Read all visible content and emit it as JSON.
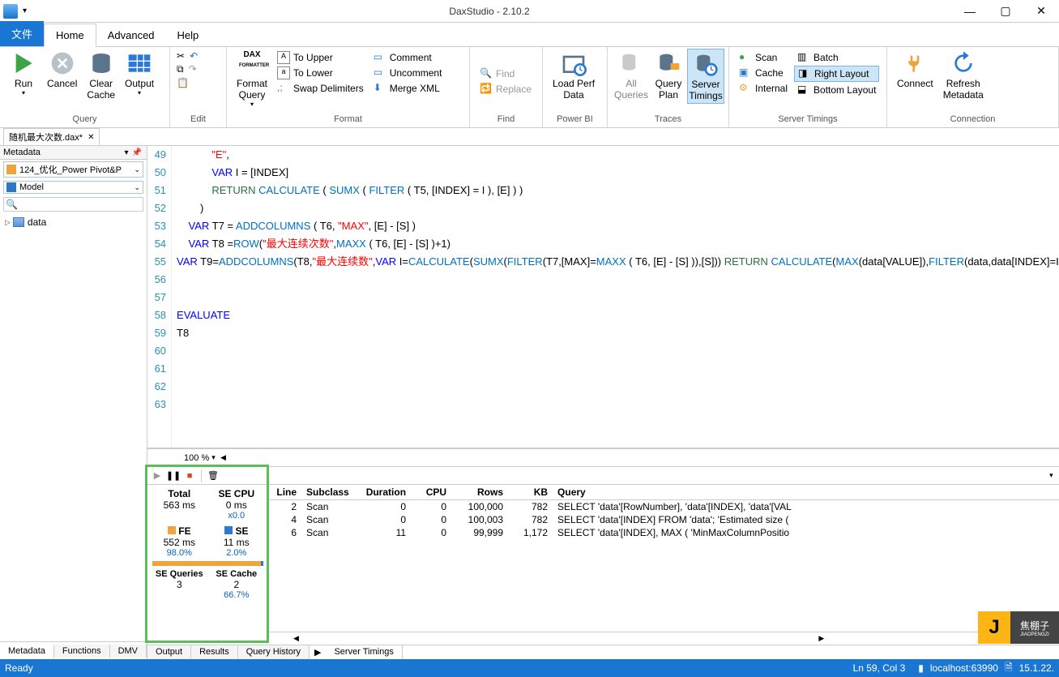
{
  "titlebar": {
    "title": "DaxStudio - 2.10.2"
  },
  "tabs": {
    "file": "文件",
    "home": "Home",
    "advanced": "Advanced",
    "help": "Help"
  },
  "ribbon": {
    "query": {
      "label": "Query",
      "run": "Run",
      "cancel": "Cancel",
      "clear_cache": "Clear\nCache",
      "output": "Output"
    },
    "edit": {
      "label": "Edit"
    },
    "format": {
      "label": "Format",
      "format_query": "Format\nQuery",
      "to_upper": "To Upper",
      "to_lower": "To Lower",
      "swap": "Swap Delimiters",
      "comment": "Comment",
      "uncomment": "Uncomment",
      "merge_xml": "Merge XML"
    },
    "find": {
      "label": "Find",
      "find": "Find",
      "replace": "Replace"
    },
    "powerbi": {
      "label": "Power BI",
      "load_perf": "Load Perf\nData"
    },
    "traces": {
      "label": "Traces",
      "all_queries": "All\nQueries",
      "query_plan": "Query\nPlan",
      "server_timings": "Server\nTimings"
    },
    "server_timings": {
      "label": "Server Timings",
      "scan": "Scan",
      "cache": "Cache",
      "internal": "Internal",
      "batch": "Batch",
      "right_layout": "Right Layout",
      "bottom_layout": "Bottom Layout"
    },
    "connection": {
      "label": "Connection",
      "connect": "Connect",
      "refresh": "Refresh\nMetadata"
    }
  },
  "doctab": {
    "name": "随机最大次数.dax*"
  },
  "metadata": {
    "title": "Metadata",
    "db": "124_优化_Power Pivot&P",
    "model": "Model",
    "table": "data"
  },
  "editor": {
    "zoom": "100 %",
    "lines": [
      {
        "n": 49,
        "ind": 3,
        "seg": [
          {
            "t": "\"E\"",
            "c": "strcn"
          },
          {
            "t": ",",
            "c": ""
          }
        ]
      },
      {
        "n": 50,
        "ind": 3,
        "seg": [
          {
            "t": "VAR",
            "c": "kw"
          },
          {
            "t": " I = [INDEX]",
            "c": ""
          }
        ]
      },
      {
        "n": 51,
        "ind": 3,
        "seg": [
          {
            "t": "RETURN",
            "c": "rtn"
          },
          {
            "t": " ",
            "c": ""
          },
          {
            "t": "CALCULATE",
            "c": "fn"
          },
          {
            "t": " ( ",
            "c": ""
          },
          {
            "t": "SUMX",
            "c": "fn"
          },
          {
            "t": " ( ",
            "c": ""
          },
          {
            "t": "FILTER",
            "c": "fn"
          },
          {
            "t": " ( T5, [INDEX] = I ), [E] ) )",
            "c": ""
          }
        ]
      },
      {
        "n": 52,
        "ind": 2,
        "seg": [
          {
            "t": ")",
            "c": ""
          }
        ]
      },
      {
        "n": 53,
        "ind": 1,
        "seg": [
          {
            "t": "VAR",
            "c": "kw"
          },
          {
            "t": " T7 = ",
            "c": ""
          },
          {
            "t": "ADDCOLUMNS",
            "c": "fn"
          },
          {
            "t": " ( T6, ",
            "c": ""
          },
          {
            "t": "\"MAX\"",
            "c": "strcn"
          },
          {
            "t": ", [E] - [S] )",
            "c": ""
          }
        ]
      },
      {
        "n": 54,
        "ind": 1,
        "seg": [
          {
            "t": "VAR",
            "c": "kw"
          },
          {
            "t": " T8 =",
            "c": ""
          },
          {
            "t": "ROW",
            "c": "fn"
          },
          {
            "t": "(",
            "c": ""
          },
          {
            "t": "\"最大连续次数\"",
            "c": "strcn"
          },
          {
            "t": ",",
            "c": ""
          },
          {
            "t": "MAXX",
            "c": "fn"
          },
          {
            "t": " ( T6, [E] - [S] )+1)",
            "c": ""
          }
        ]
      },
      {
        "n": 55,
        "ind": 0,
        "seg": [
          {
            "t": "VAR",
            "c": "kw"
          },
          {
            "t": " T9=",
            "c": ""
          },
          {
            "t": "ADDCOLUMNS",
            "c": "fn"
          },
          {
            "t": "(T8,",
            "c": ""
          },
          {
            "t": "\"最大连续数\"",
            "c": "strcn"
          },
          {
            "t": ",",
            "c": ""
          },
          {
            "t": "VAR",
            "c": "kw"
          },
          {
            "t": " I=",
            "c": ""
          },
          {
            "t": "CALCULATE",
            "c": "fn"
          },
          {
            "t": "(",
            "c": ""
          },
          {
            "t": "SUMX",
            "c": "fn"
          },
          {
            "t": "(",
            "c": ""
          },
          {
            "t": "FILTER",
            "c": "fn"
          },
          {
            "t": "(T7,[MAX]=",
            "c": ""
          },
          {
            "t": "MAXX",
            "c": "fn"
          },
          {
            "t": " ( T6, [E] - [S] )),[S])) ",
            "c": ""
          },
          {
            "t": "RETURN",
            "c": "rtn"
          },
          {
            "t": " ",
            "c": ""
          },
          {
            "t": "CALCULATE",
            "c": "fn"
          },
          {
            "t": "(",
            "c": ""
          },
          {
            "t": "MAX",
            "c": "fn"
          },
          {
            "t": "(data[VALUE]),",
            "c": ""
          },
          {
            "t": "FILTER",
            "c": "fn"
          },
          {
            "t": "(data,data[INDEX]=I) ))",
            "c": ""
          }
        ]
      },
      {
        "n": 56,
        "ind": 0,
        "seg": []
      },
      {
        "n": 57,
        "ind": 0,
        "seg": []
      },
      {
        "n": 58,
        "ind": 0,
        "seg": [
          {
            "t": "EVALUATE",
            "c": "kw"
          }
        ]
      },
      {
        "n": 59,
        "ind": 0,
        "seg": [
          {
            "t": "T8",
            "c": ""
          }
        ]
      },
      {
        "n": 60,
        "ind": 0,
        "seg": []
      },
      {
        "n": 61,
        "ind": 0,
        "seg": []
      },
      {
        "n": 62,
        "ind": 0,
        "seg": []
      },
      {
        "n": 63,
        "ind": 0,
        "seg": []
      }
    ]
  },
  "timings": {
    "stats": {
      "total_h": "Total",
      "total": "563 ms",
      "secpu_h": "SE CPU",
      "secpu": "0 ms",
      "secpu_x": "x0.0",
      "fe_h": "FE",
      "fe": "552 ms",
      "fe_pct": "98.0%",
      "se_h": "SE",
      "se": "11 ms",
      "se_pct": "2.0%",
      "seq_h": "SE Queries",
      "seq": "3",
      "sec_h": "SE Cache",
      "sec": "2",
      "sec_pct": "66.7%"
    },
    "cols": {
      "line": "Line",
      "subclass": "Subclass",
      "duration": "Duration",
      "cpu": "CPU",
      "rows": "Rows",
      "kb": "KB",
      "query": "Query"
    },
    "rows": [
      {
        "line": "2",
        "subclass": "Scan",
        "duration": "0",
        "cpu": "0",
        "rows": "100,000",
        "kb": "782",
        "query": "SELECT 'data'[RowNumber], 'data'[INDEX], 'data'[VAL"
      },
      {
        "line": "4",
        "subclass": "Scan",
        "duration": "0",
        "cpu": "0",
        "rows": "100,003",
        "kb": "782",
        "query": "SELECT 'data'[INDEX] FROM 'data';   'Estimated size ("
      },
      {
        "line": "6",
        "subclass": "Scan",
        "duration": "11",
        "cpu": "0",
        "rows": "99,999",
        "kb": "1,172",
        "query": "SELECT 'data'[INDEX], MAX ( 'MinMaxColumnPositio"
      }
    ]
  },
  "left_tabs": {
    "metadata": "Metadata",
    "functions": "Functions",
    "dmv": "DMV"
  },
  "right_tabs": {
    "output": "Output",
    "results": "Results",
    "history": "Query History",
    "server": "Server Timings"
  },
  "status": {
    "ready": "Ready",
    "pos": "Ln 59, Col 3",
    "host": "localhost:63990",
    "ver": "15.1.22."
  },
  "logo": {
    "j": "J",
    "txt": "焦棚子",
    "sub": "JIAOPENGZI"
  }
}
